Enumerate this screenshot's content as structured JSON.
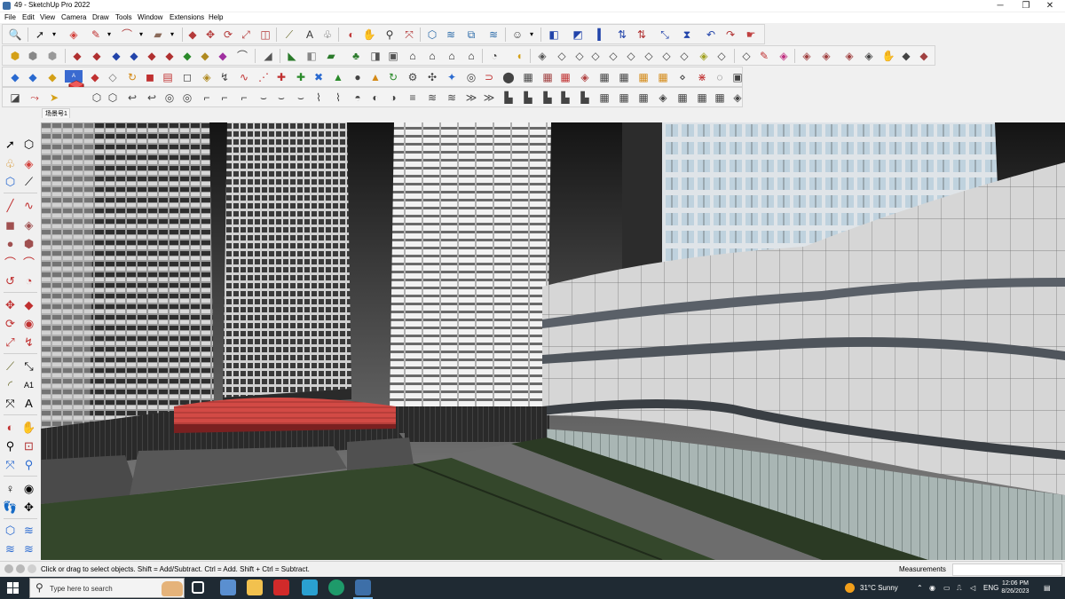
{
  "window": {
    "title": "49 - SketchUp Pro 2022",
    "minimize_glyph": "─",
    "maximize_glyph": "❐",
    "close_glyph": "✕"
  },
  "menu": [
    "File",
    "Edit",
    "View",
    "Camera",
    "Draw",
    "Tools",
    "Window",
    "Extensions",
    "Help"
  ],
  "scene_tab": "场景号1",
  "status": {
    "hint": "Click or drag to select objects. Shift = Add/Subtract. Ctrl = Add. Shift + Ctrl = Subtract.",
    "measurements_label": "Measurements",
    "measurements_value": ""
  },
  "taskbar": {
    "search_placeholder": "Type here to search",
    "weather": "31°C  Sunny",
    "language": "ENG",
    "time": "12:06 PM",
    "date": "8/26/2023"
  },
  "colors": {
    "accent": "#0078d7",
    "toolbar_bg": "#f3f3f3",
    "taskbar_bg": "#1f2a33",
    "ground_green": "#34472b",
    "selection_red": "#d24a45"
  }
}
